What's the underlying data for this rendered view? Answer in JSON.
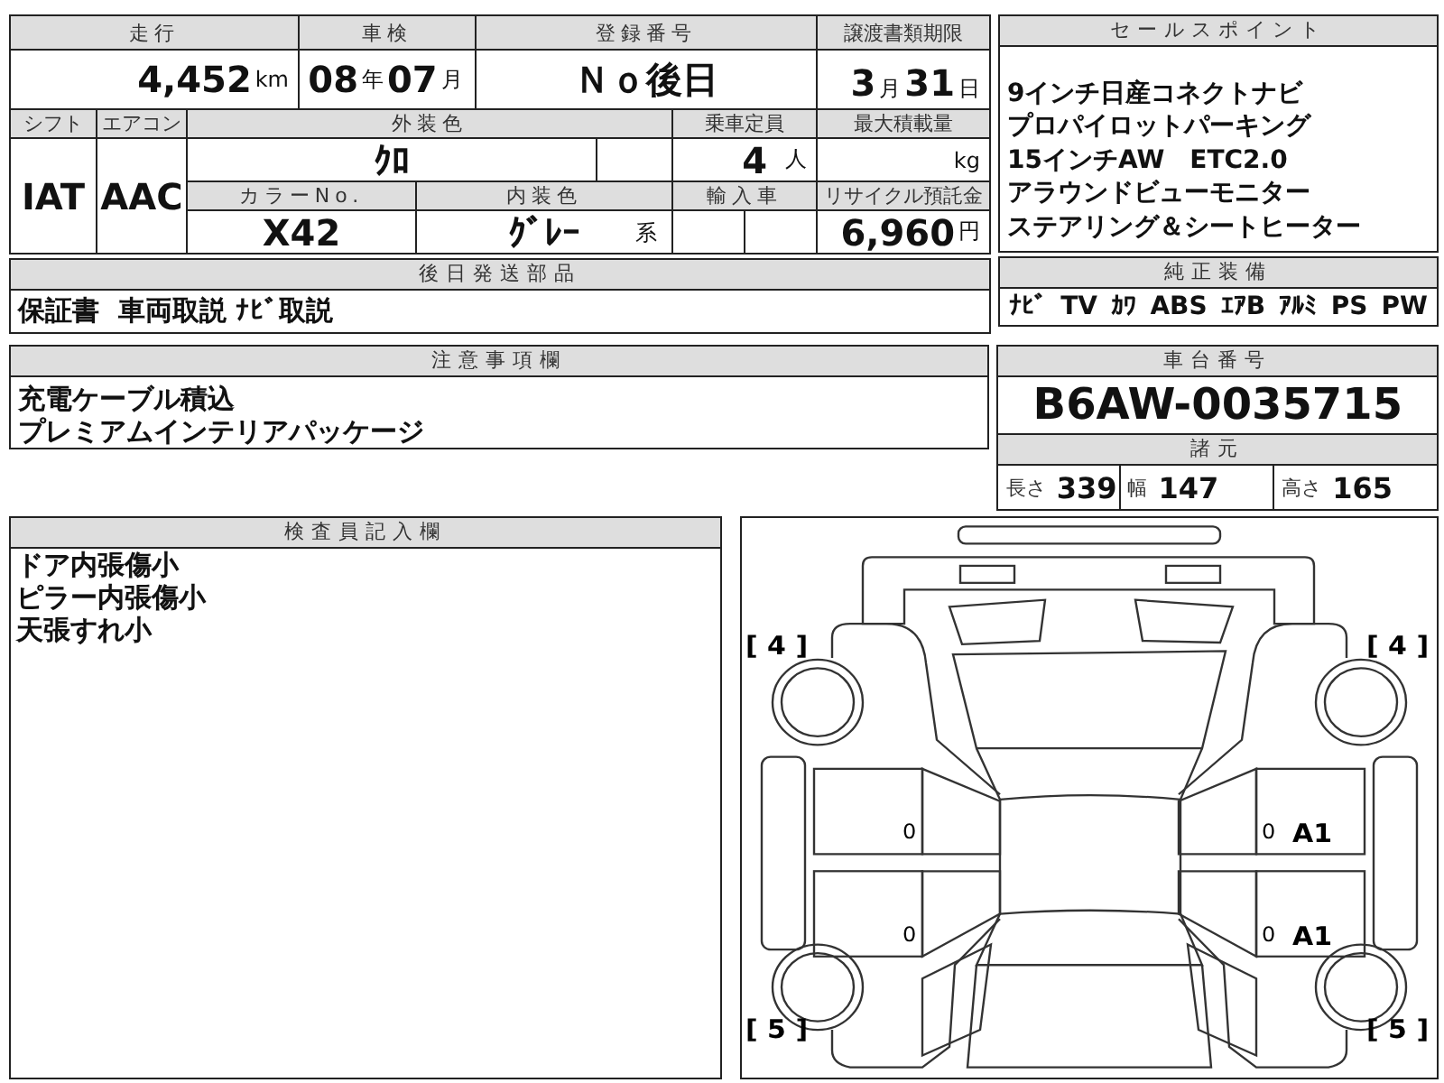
{
  "mileage": {
    "label": "走行",
    "value": "4,452",
    "unit": "km"
  },
  "inspection": {
    "label": "車検",
    "year": "08",
    "year_unit": "年",
    "month": "07",
    "month_unit": "月"
  },
  "registration_number": {
    "label": "登録番号",
    "value": "Ｎｏ後日"
  },
  "transfer_deadline": {
    "label": "譲渡書類期限",
    "month": "3",
    "month_unit": "月",
    "day": "31",
    "day_unit": "日"
  },
  "shift": {
    "label": "シフト",
    "value": "IAT"
  },
  "air_conditioner": {
    "label": "エアコン",
    "value": "AAC"
  },
  "exterior_color": {
    "label": "外装色",
    "value": "ｸﾛ"
  },
  "capacity": {
    "label": "乗車定員",
    "value": "4",
    "unit": "人"
  },
  "max_load": {
    "label": "最大積載量",
    "unit": "kg"
  },
  "color_number": {
    "label": "カラーNo.",
    "value": "X42"
  },
  "interior_color": {
    "label": "内装色",
    "value": "ｸﾞﾚｰ",
    "suffix": "系"
  },
  "import": {
    "label": "輸入車"
  },
  "recycle_fee": {
    "label": "リサイクル預託金",
    "value": "6,960",
    "unit": "円"
  },
  "parts_sent_later": {
    "label": "後日発送部品",
    "value": "保証書  車両取説 ﾅﾋﾞ取説"
  },
  "sales_points": {
    "label": "セールスポイント",
    "lines": [
      "9インチ日産コネクトナビ",
      "プロパイロットパーキング",
      "15インチAW　ETC2.0",
      "アラウンドビューモニター",
      "ステアリング＆シートヒーター"
    ]
  },
  "equipment": {
    "label": "純正装備",
    "items": [
      "ﾅﾋﾞ",
      "TV",
      "ｶﾜ",
      "ABS",
      "ｴｱB",
      "ｱﾙﾐ",
      "PS",
      "PW"
    ]
  },
  "notes": {
    "label": "注意事項欄",
    "lines": [
      "充電ケーブル積込",
      "プレミアムインテリアパッケージ"
    ]
  },
  "chassis": {
    "label": "車台番号",
    "value": "B6AW-0035715"
  },
  "specs": {
    "label": "諸元",
    "items": [
      {
        "label": "長さ",
        "value": "339"
      },
      {
        "label": "幅",
        "value": "147"
      },
      {
        "label": "高さ",
        "value": "165"
      }
    ]
  },
  "inspector_notes": {
    "label": "検査員記入欄",
    "lines": [
      "ドア内張傷小",
      "ピラー内張傷小",
      "天張すれ小"
    ]
  },
  "diagram": {
    "tire_front_left": "[ 4 ]",
    "tire_front_right": "[ 4 ]",
    "tire_rear_left": "[ 5 ]",
    "tire_rear_right": "[ 5 ]",
    "left_door_marks": [
      "0",
      "0"
    ],
    "right_door_marks": [
      {
        "text": "0",
        "code": "A1"
      },
      {
        "text": "0",
        "code": "A1"
      }
    ]
  }
}
